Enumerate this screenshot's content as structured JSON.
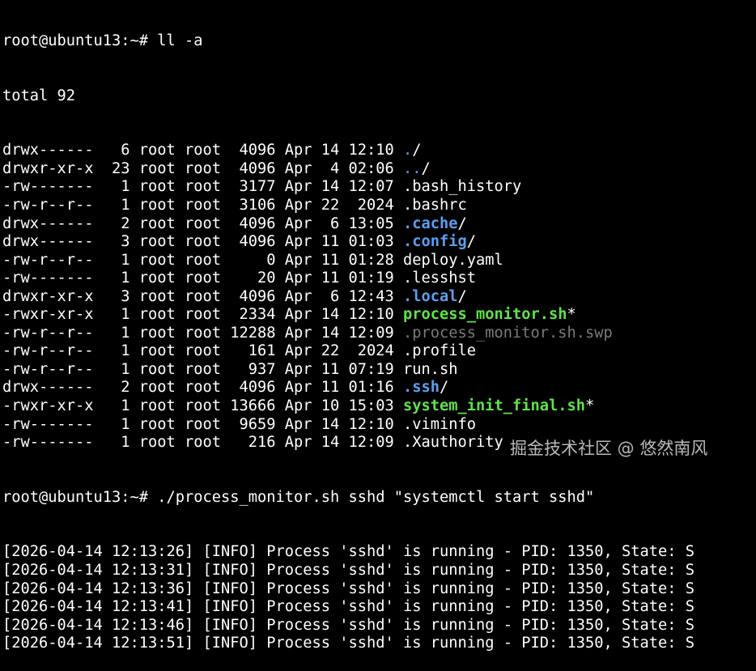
{
  "terminal": {
    "prompt1": "root@ubuntu13:~# ll -a",
    "total": "total 92",
    "listing": [
      {
        "perm": "drwx------",
        "links": "6",
        "owner": "root",
        "group": "root",
        "size": "4096",
        "month": "Apr",
        "day": "14",
        "time": "12:10",
        "name": ".",
        "suffix": "/",
        "kind": "dir-plain"
      },
      {
        "perm": "drwxr-xr-x",
        "links": "23",
        "owner": "root",
        "group": "root",
        "size": "4096",
        "month": "Apr",
        "day": "4",
        "time": "02:06",
        "name": "..",
        "suffix": "/",
        "kind": "dir-plain"
      },
      {
        "perm": "-rw-------",
        "links": "1",
        "owner": "root",
        "group": "root",
        "size": "3177",
        "month": "Apr",
        "day": "14",
        "time": "12:07",
        "name": ".bash_history",
        "suffix": "",
        "kind": "file"
      },
      {
        "perm": "-rw-r--r--",
        "links": "1",
        "owner": "root",
        "group": "root",
        "size": "3106",
        "month": "Apr",
        "day": "22",
        "time": "2024",
        "name": ".bashrc",
        "suffix": "",
        "kind": "file"
      },
      {
        "perm": "drwx------",
        "links": "2",
        "owner": "root",
        "group": "root",
        "size": "4096",
        "month": "Apr",
        "day": "6",
        "time": "13:05",
        "name": ".cache",
        "suffix": "/",
        "kind": "dir"
      },
      {
        "perm": "drwx------",
        "links": "3",
        "owner": "root",
        "group": "root",
        "size": "4096",
        "month": "Apr",
        "day": "11",
        "time": "01:03",
        "name": ".config",
        "suffix": "/",
        "kind": "dir"
      },
      {
        "perm": "-rw-r--r--",
        "links": "1",
        "owner": "root",
        "group": "root",
        "size": "0",
        "month": "Apr",
        "day": "11",
        "time": "01:28",
        "name": "deploy.yaml",
        "suffix": "",
        "kind": "file"
      },
      {
        "perm": "-rw-------",
        "links": "1",
        "owner": "root",
        "group": "root",
        "size": "20",
        "month": "Apr",
        "day": "11",
        "time": "01:19",
        "name": ".lesshst",
        "suffix": "",
        "kind": "file"
      },
      {
        "perm": "drwxr-xr-x",
        "links": "3",
        "owner": "root",
        "group": "root",
        "size": "4096",
        "month": "Apr",
        "day": "6",
        "time": "12:43",
        "name": ".local",
        "suffix": "/",
        "kind": "dir"
      },
      {
        "perm": "-rwxr-xr-x",
        "links": "1",
        "owner": "root",
        "group": "root",
        "size": "2334",
        "month": "Apr",
        "day": "14",
        "time": "12:10",
        "name": "process_monitor.sh",
        "suffix": "*",
        "kind": "exec"
      },
      {
        "perm": "-rw-r--r--",
        "links": "1",
        "owner": "root",
        "group": "root",
        "size": "12288",
        "month": "Apr",
        "day": "14",
        "time": "12:09",
        "name": ".process_monitor.sh.swp",
        "suffix": "",
        "kind": "dim"
      },
      {
        "perm": "-rw-r--r--",
        "links": "1",
        "owner": "root",
        "group": "root",
        "size": "161",
        "month": "Apr",
        "day": "22",
        "time": "2024",
        "name": ".profile",
        "suffix": "",
        "kind": "file"
      },
      {
        "perm": "-rw-r--r--",
        "links": "1",
        "owner": "root",
        "group": "root",
        "size": "937",
        "month": "Apr",
        "day": "11",
        "time": "07:19",
        "name": "run.sh",
        "suffix": "",
        "kind": "file"
      },
      {
        "perm": "drwx------",
        "links": "2",
        "owner": "root",
        "group": "root",
        "size": "4096",
        "month": "Apr",
        "day": "11",
        "time": "01:16",
        "name": ".ssh",
        "suffix": "/",
        "kind": "dir"
      },
      {
        "perm": "-rwxr-xr-x",
        "links": "1",
        "owner": "root",
        "group": "root",
        "size": "13666",
        "month": "Apr",
        "day": "10",
        "time": "15:03",
        "name": "system_init_final.sh",
        "suffix": "*",
        "kind": "exec"
      },
      {
        "perm": "-rw-------",
        "links": "1",
        "owner": "root",
        "group": "root",
        "size": "9659",
        "month": "Apr",
        "day": "14",
        "time": "12:10",
        "name": ".viminfo",
        "suffix": "",
        "kind": "file"
      },
      {
        "perm": "-rw-------",
        "links": "1",
        "owner": "root",
        "group": "root",
        "size": "216",
        "month": "Apr",
        "day": "14",
        "time": "12:09",
        "name": ".Xauthority",
        "suffix": "",
        "kind": "file"
      }
    ],
    "prompt2": "root@ubuntu13:~# ./process_monitor.sh sshd \"systemctl start sshd\"",
    "log": [
      "[2026-04-14 12:13:26] [INFO] Process 'sshd' is running - PID: 1350, State: S",
      "[2026-04-14 12:13:31] [INFO] Process 'sshd' is running - PID: 1350, State: S",
      "[2026-04-14 12:13:36] [INFO] Process 'sshd' is running - PID: 1350, State: S",
      "[2026-04-14 12:13:41] [INFO] Process 'sshd' is running - PID: 1350, State: S",
      "[2026-04-14 12:13:46] [INFO] Process 'sshd' is running - PID: 1350, State: S",
      "[2026-04-14 12:13:51] [INFO] Process 'sshd' is running - PID: 1350, State: S"
    ]
  },
  "watermark": "掘金技术社区 @ 悠然南风",
  "colors": {
    "background": "#000000",
    "text": "#ffffff",
    "directory": "#5c9ef0",
    "executable": "#5fe34a",
    "swap_file": "#7a7a7a"
  }
}
